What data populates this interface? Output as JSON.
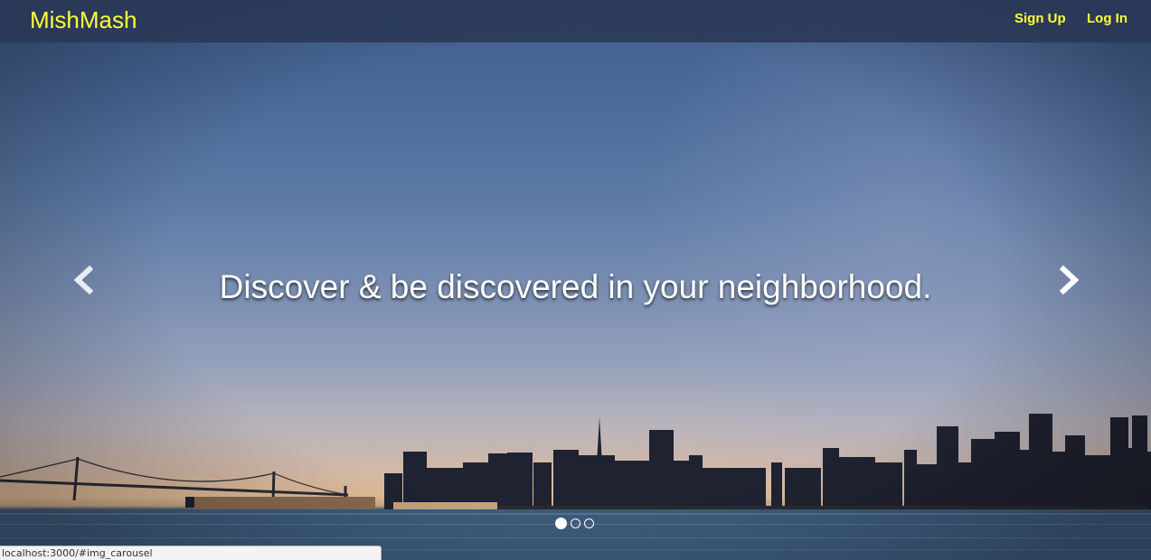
{
  "navbar": {
    "brand": "MishMash",
    "links": [
      {
        "label": "Sign Up"
      },
      {
        "label": "Log In"
      }
    ]
  },
  "carousel": {
    "caption": "Discover & be discovered in your neighborhood.",
    "prev_icon": "chevron-left-icon",
    "next_icon": "chevron-right-icon",
    "slide_count": 3,
    "active_index": 0
  },
  "statusbar": {
    "url": "localhost:3000/#img_carousel"
  },
  "colors": {
    "brand": "#ffff33",
    "navbar": "#2a3856",
    "caption": "#ffffff"
  }
}
